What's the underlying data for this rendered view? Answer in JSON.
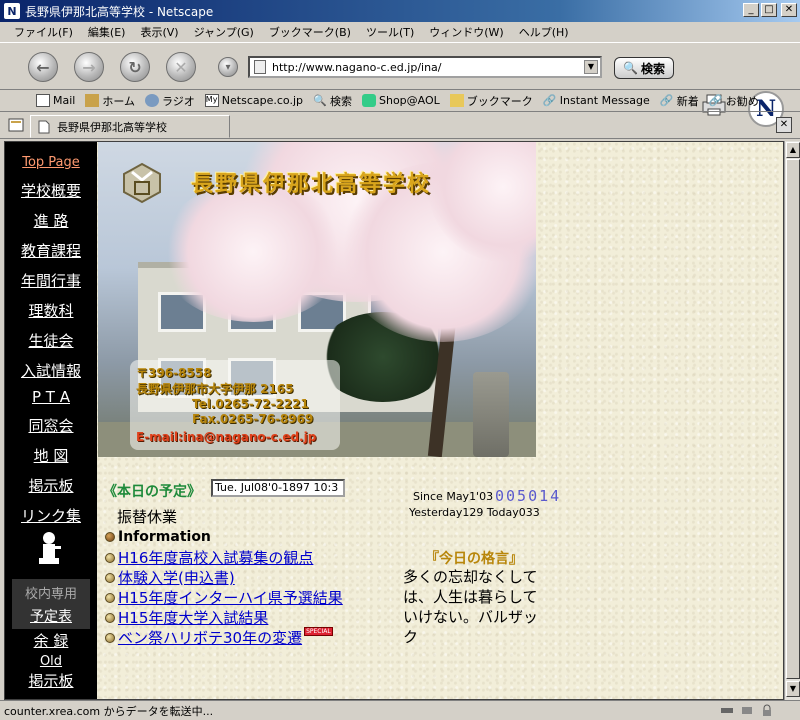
{
  "window": {
    "title": "長野県伊那北高等学校 - Netscape"
  },
  "menu": [
    "ファイル(F)",
    "編集(E)",
    "表示(V)",
    "ジャンプ(G)",
    "ブックマーク(B)",
    "ツール(T)",
    "ウィンドウ(W)",
    "ヘルプ(H)"
  ],
  "nav": {
    "url": "http://www.nagano-c.ed.jp/ina/",
    "search_label": "検索"
  },
  "personal_toolbar": [
    "Mail",
    "ホーム",
    "ラジオ",
    "Netscape.co.jp",
    "検索",
    "Shop@AOL",
    "ブックマーク",
    "Instant Message",
    "新着",
    "お勧め"
  ],
  "personal_toolbar_icon_my": "My",
  "tab": {
    "label": "長野県伊那北高等学校"
  },
  "sidebar": {
    "links": [
      "Top Page",
      "学校概要",
      "進 路",
      "教育課程",
      "年間行事",
      "理数科",
      "生徒会",
      "入試情報",
      "P T A",
      "同窓会",
      "地 図",
      "掲示板",
      "リンク集"
    ],
    "staff_label": "校内専用",
    "staff_link": "予定表",
    "extra_links": [
      "余 録",
      "Old",
      "掲示板"
    ]
  },
  "hero": {
    "title": "長野県伊那北高等学校",
    "address": [
      "〒396-8558",
      "長野県伊那市大字伊那 2165",
      "Tel.0265-72-2221",
      "Fax.0265-76-8969",
      "E-mail:ina@nagano-c.ed.jp"
    ]
  },
  "schedule": {
    "label": "《本日の予定》",
    "ticker": "Tue. Jul08'0-1897 10:3",
    "today": "振替休業"
  },
  "counter": {
    "since": "Since May1'03",
    "count": "005014",
    "stats": "Yesterday129 Today033"
  },
  "information": {
    "header": "Information",
    "items": [
      "H16年度高校入試募集の観点",
      "体験入学(申込書)",
      "H15年度インターハイ県予選結果",
      "H15年度大学入試結果",
      "ベン祭ハリボテ30年の変遷"
    ],
    "special_badge": "SPECIAL"
  },
  "motto": {
    "header": "『今日の格言』",
    "text": "多くの忘却なくしては、人生は暮らしていけない。バルザック"
  },
  "status": {
    "text": "counter.xrea.com からデータを転送中..."
  }
}
